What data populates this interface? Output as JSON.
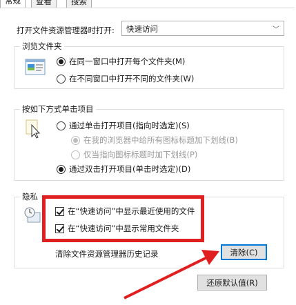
{
  "tabs": [
    {
      "label": "常规",
      "active": true
    },
    {
      "label": "查看",
      "active": false
    },
    {
      "label": "搜索",
      "active": false
    }
  ],
  "open_explorer": {
    "label": "打开文件资源管理器时打开:",
    "selected": "快速访问"
  },
  "browse_folders": {
    "title": "浏览文件夹",
    "options": [
      {
        "label": "在同一窗口中打开每个文件夹(M)",
        "checked": true
      },
      {
        "label": "在不同窗口中打开不同的文件夹(W)",
        "checked": false
      }
    ]
  },
  "click_items": {
    "title": "按如下方式单击项目",
    "options": [
      {
        "label": "通过单击打开项目(指向时选定)(S)",
        "checked": false
      },
      {
        "label": "在我的浏览器中给所有图标标题加下划线(B)",
        "checked": true,
        "disabled": true
      },
      {
        "label": "仅当指向图标标题时加下划线(P)",
        "checked": false,
        "disabled": true
      },
      {
        "label": "通过双击打开项目(单击时选定)(D)",
        "checked": true
      }
    ]
  },
  "privacy": {
    "title": "隐私",
    "checks": [
      {
        "label": "在“快速访问”中显示最近使用的文件",
        "checked": true
      },
      {
        "label": "在“快速访问”中显示常用文件夹",
        "checked": true
      }
    ],
    "clear_label": "清除文件资源管理器历史记录",
    "clear_button": "清除(C)"
  },
  "restore_button": "还原默认值(R)",
  "colors": {
    "highlight": "#e02020",
    "focus": "#0078d7"
  }
}
